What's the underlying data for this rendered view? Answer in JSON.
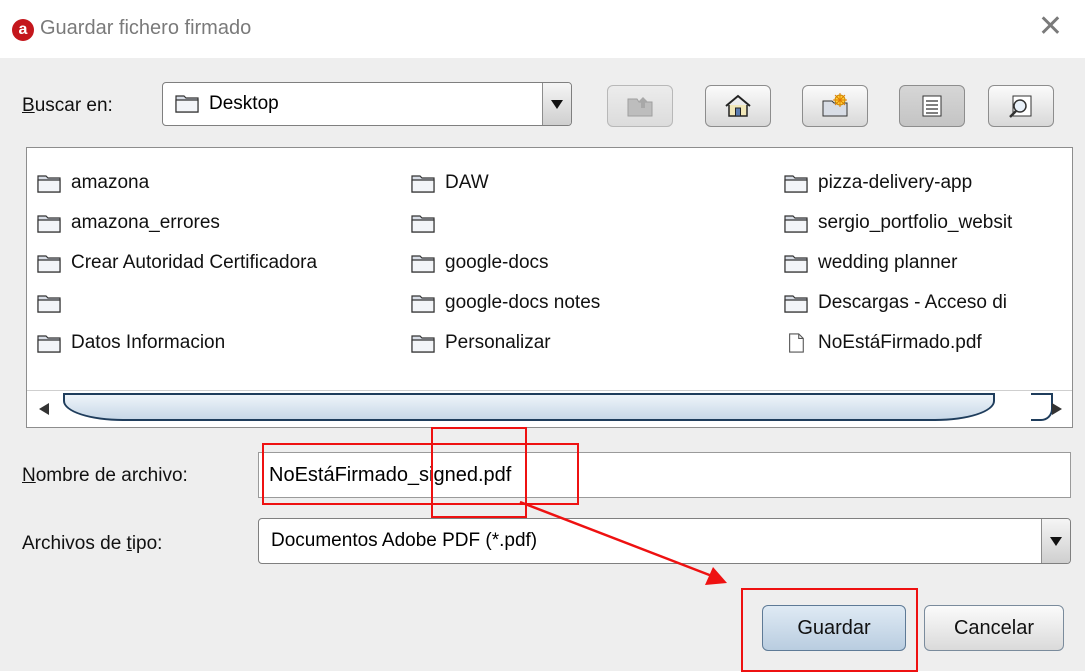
{
  "window": {
    "title": "Guardar fichero firmado",
    "app_icon_letter": "a"
  },
  "look_in": {
    "label": "Buscar en:",
    "mnemonic": "B",
    "rest": "uscar en:",
    "value": "Desktop"
  },
  "toolbar": {
    "icons": [
      "up-folder-icon",
      "home-icon",
      "new-folder-icon",
      "list-view-icon",
      "details-view-icon"
    ]
  },
  "files": [
    {
      "name": "amazona",
      "type": "folder"
    },
    {
      "name": "amazona_errores",
      "type": "folder"
    },
    {
      "name": "Crear Autoridad Certificadora",
      "type": "folder"
    },
    {
      "name": "",
      "type": "folder"
    },
    {
      "name": "Datos Informacion",
      "type": "folder"
    },
    {
      "name": "DAW",
      "type": "folder"
    },
    {
      "name": "",
      "type": "folder"
    },
    {
      "name": "google-docs",
      "type": "folder"
    },
    {
      "name": "google-docs notes",
      "type": "folder"
    },
    {
      "name": "Personalizar",
      "type": "folder"
    },
    {
      "name": "pizza-delivery-app",
      "type": "folder"
    },
    {
      "name": "sergio_portfolio_websit",
      "type": "folder"
    },
    {
      "name": "wedding planner",
      "type": "folder"
    },
    {
      "name": "Descargas - Acceso di",
      "type": "folder"
    },
    {
      "name": "NoEstáFirmado.pdf",
      "type": "file"
    }
  ],
  "filename": {
    "mnemonic": "N",
    "rest": "ombre de archivo:",
    "value": "NoEstáFirmado_signed.pdf"
  },
  "filetype": {
    "prefix": "Archivos de ",
    "mnemonic": "t",
    "rest": "ipo:",
    "value": "Documentos Adobe PDF (*.pdf)"
  },
  "buttons": {
    "save": "Guardar",
    "cancel": "Cancelar"
  },
  "colors": {
    "annotation": "#ee1111",
    "app_brand": "#c4161c",
    "dialog_bg": "#eeeeee",
    "scroll_thumb_border": "#1f3d5c"
  }
}
